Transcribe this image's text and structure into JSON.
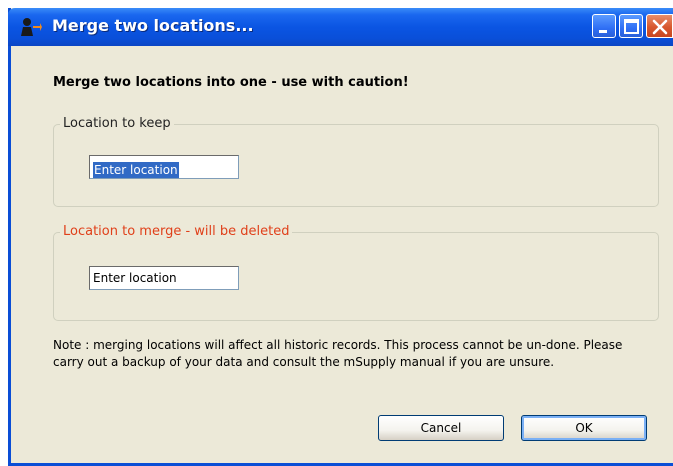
{
  "window": {
    "title": "Merge two locations...",
    "app_icon": "person-arrow-icon",
    "controls": [
      "minimize-icon",
      "maximize-icon",
      "close-icon"
    ]
  },
  "dialog": {
    "heading": "Merge two locations into one - use with caution!",
    "keep_group": {
      "label": "Location to keep",
      "input_value": "Enter location"
    },
    "merge_group": {
      "label": "Location to merge - will be deleted",
      "label_color": "#e0401a",
      "input_value": "Enter location"
    },
    "note": "Note : merging locations will affect all historic records. This process cannot be un-done.  Please carry out a backup of your data and  consult the mSupply manual if you are unsure.",
    "buttons": {
      "cancel": "Cancel",
      "ok": "OK"
    }
  },
  "colors": {
    "titlebar": "#0b55e3",
    "dialog_background": "#ece9d8",
    "selection": "#316ac5"
  }
}
